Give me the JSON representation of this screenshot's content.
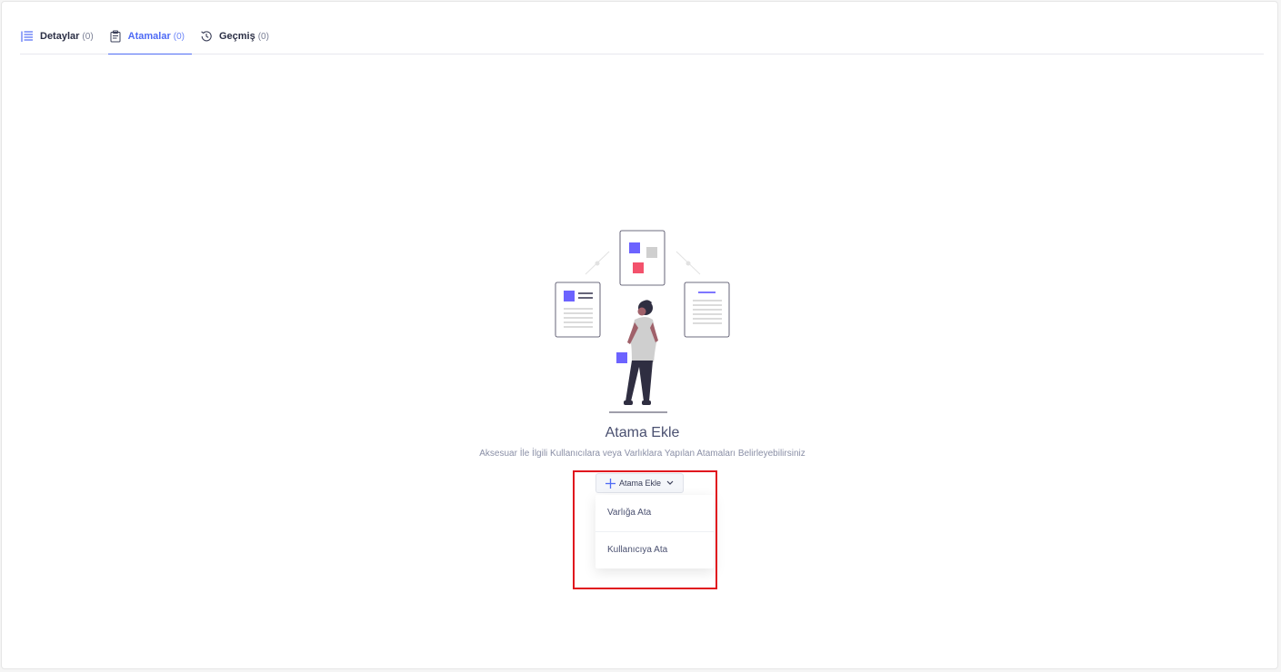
{
  "tabs": [
    {
      "label": "Detaylar",
      "count": "(0)",
      "icon": "list-icon",
      "active": false
    },
    {
      "label": "Atamalar",
      "count": "(0)",
      "icon": "assignment-clipboard-icon",
      "active": true
    },
    {
      "label": "Geçmiş",
      "count": "(0)",
      "icon": "history-clock-icon",
      "active": false
    }
  ],
  "empty_state": {
    "title": "Atama Ekle",
    "subtitle": "Aksesuar İle İlgili Kullanıcılara veya Varlıklara Yapılan Atamaları Belirleyebilirsiniz"
  },
  "add_dropdown": {
    "button_label": "Atama Ekle",
    "items": [
      "Varlığa Ata",
      "Kullanıcıya Ata"
    ]
  },
  "colors": {
    "accent": "#4f6bf5",
    "illustration_purple": "#6c63ff",
    "illustration_red": "#f3526c",
    "highlight_box": "#e0141e"
  }
}
